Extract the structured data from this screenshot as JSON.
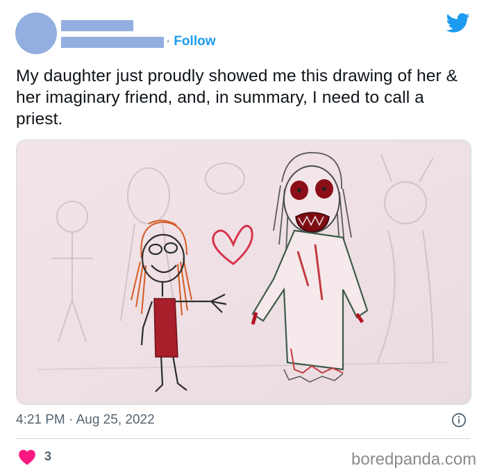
{
  "tweet": {
    "follow_label": "Follow",
    "follow_separator": "·",
    "text": "My daughter just proudly showed me this drawing of her & her imaginary friend, and, in summary, I need to call a priest.",
    "timestamp": "4:21 PM · Aug 25, 2022",
    "like_count": "3"
  },
  "icons": {
    "brand": "twitter-bird-icon",
    "info": "info-icon",
    "like": "heart-icon"
  },
  "colors": {
    "accent": "#1d9bf0",
    "redaction": "#93aee0",
    "like": "#f91880"
  },
  "watermark": "boredpanda.com"
}
